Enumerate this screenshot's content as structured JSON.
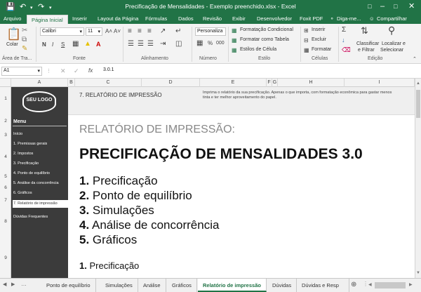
{
  "window": {
    "title": "Precificação de Mensalidades - Exemplo preenchido.xlsx  -  Excel"
  },
  "ribbon_tabs": [
    "Arquivo",
    "Página Inicial",
    "Inserir",
    "Layout da Página",
    "Fórmulas",
    "Dados",
    "Revisão",
    "Exibir",
    "Desenvolvedor",
    "Foxit PDF"
  ],
  "tell_me": "Diga-me...",
  "share": "Compartilhar",
  "ribbon": {
    "paste": "Colar",
    "clipboard": "Área de Tra...",
    "font_name": "Calibri",
    "font_size": "11",
    "bold": "N",
    "italic": "I",
    "underline": "S",
    "font_group": "Fonte",
    "alignment_group": "Alinhamento",
    "number_format": "Personaliza",
    "percent": "%",
    "thousands": "000",
    "number_group": "Número",
    "cond_format": "Formatação Condicional",
    "format_table": "Formatar como Tabela",
    "cell_styles": "Estilos de Célula",
    "styles_group": "Estilo",
    "insert": "Inserir",
    "delete": "Excluir",
    "format": "Formatar",
    "cells_group": "Células",
    "sort_filter_1": "Classificar",
    "sort_filter_2": "e Filtrar",
    "find_select_1": "Localizar e",
    "find_select_2": "Selecionar",
    "editing_group": "Edição"
  },
  "formula_bar": {
    "name_box": "A1",
    "fx": "fx",
    "value": "3.0.1"
  },
  "columns": [
    "A",
    "B",
    "C",
    "D",
    "E",
    "F",
    "G",
    "H",
    "I"
  ],
  "rows": [
    "1",
    "2",
    "3",
    "4",
    "5",
    "6",
    "7",
    "8",
    "9"
  ],
  "sidebar": {
    "logo": "SEU LOGO",
    "menu_title": "Menu",
    "items": [
      "Início",
      "1. Premissas gerais",
      "2. Impostos",
      "3. Precificação",
      "4. Ponto de equilíbrio",
      "5. Análise da concorrência",
      "6. Gráficos",
      "7. Relatório de impressão",
      "Dúvidas Frequentes"
    ],
    "active_index": 7
  },
  "header": {
    "section_title": "7. RELATÓRIO DE IMPRESSÃO",
    "description": "Imprima o relatório da sua precificação. Apenas o que importa, com formatação econômica para gastar menos tinta e ter melhor aproveitamento do papel."
  },
  "report": {
    "subtitle": "RELATÓRIO DE IMPRESSÃO:",
    "title": "PRECIFICAÇÃO DE MENSALIDADES 3.0",
    "toc": [
      {
        "num": "1.",
        "text": "Precificação"
      },
      {
        "num": "2.",
        "text": "Ponto de equilíbrio"
      },
      {
        "num": "3.",
        "text": "Simulações"
      },
      {
        "num": "4.",
        "text": "Análise de concorrência"
      },
      {
        "num": "5.",
        "text": "Gráficos"
      }
    ],
    "first_section": {
      "num": "1.",
      "text": "Precificação"
    }
  },
  "sheet_tabs": [
    "Ponto de equilíbrio",
    "Simulações",
    "Análise",
    "Gráficos",
    "Relatório de impressão",
    "Dúvidas",
    "Dúvidas e Resp"
  ],
  "active_sheet_index": 4,
  "colors": {
    "excel_green": "#217346",
    "sidebar": "#3b3b3b",
    "header_band": "#efefef"
  }
}
